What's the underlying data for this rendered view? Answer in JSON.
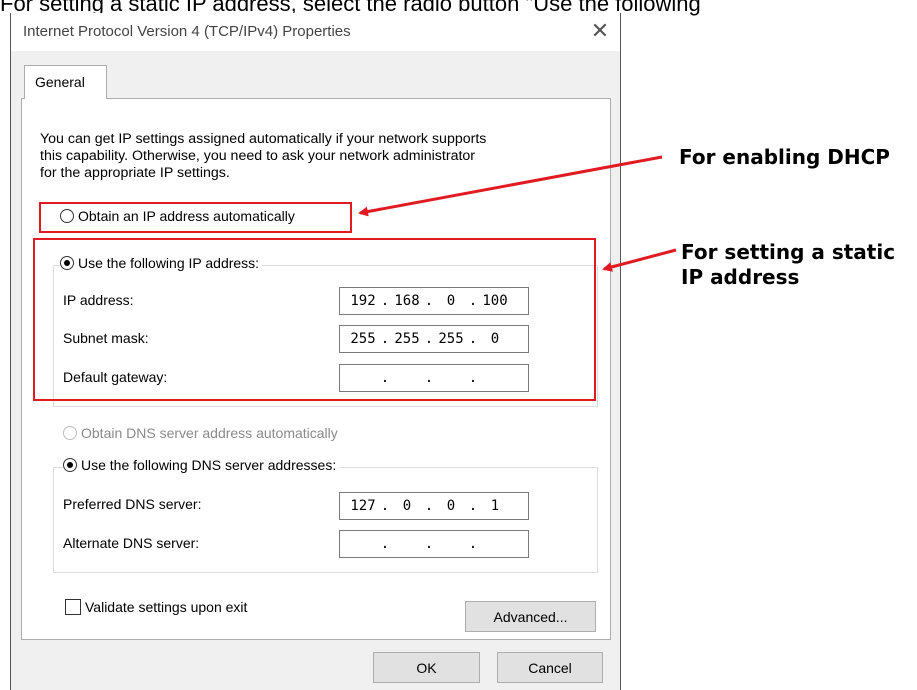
{
  "page_caption": "For setting a static IP address, select the radio button \"Use the following",
  "dialog": {
    "title": "Internet Protocol Version 4 (TCP/IPv4) Properties",
    "close_glyph": "✕",
    "tab_label": "General",
    "intro_text": "You can get IP settings assigned automatically if your network supports\nthis capability. Otherwise, you need to ask your network administrator\nfor the appropriate IP settings.",
    "ip_auto_label": "Obtain an IP address automatically",
    "ip_auto_selected": false,
    "ip_manual_label": "Use the following IP address:",
    "ip_manual_selected": true,
    "ip_address_label": "IP address:",
    "ip_address_octets": [
      "192",
      "168",
      "0",
      "100"
    ],
    "subnet_mask_label": "Subnet mask:",
    "subnet_mask_octets": [
      "255",
      "255",
      "255",
      "0"
    ],
    "default_gateway_label": "Default gateway:",
    "default_gateway_octets": [
      "",
      "",
      "",
      ""
    ],
    "dns_auto_label": "Obtain DNS server address automatically",
    "dns_auto_enabled": false,
    "dns_manual_label": "Use the following DNS server addresses:",
    "dns_manual_selected": true,
    "preferred_dns_label": "Preferred DNS server:",
    "preferred_dns_octets": [
      "127",
      "0",
      "0",
      "1"
    ],
    "alternate_dns_label": "Alternate DNS server:",
    "alternate_dns_octets": [
      "",
      "",
      "",
      ""
    ],
    "validate_label": "Validate settings upon exit",
    "validate_checked": false,
    "advanced_label": "Advanced...",
    "ok_label": "OK",
    "cancel_label": "Cancel"
  },
  "annotations": {
    "dhcp": "For enabling DHCP",
    "static": "For setting a static\nIP address",
    "highlight_color": "#e11b22"
  }
}
